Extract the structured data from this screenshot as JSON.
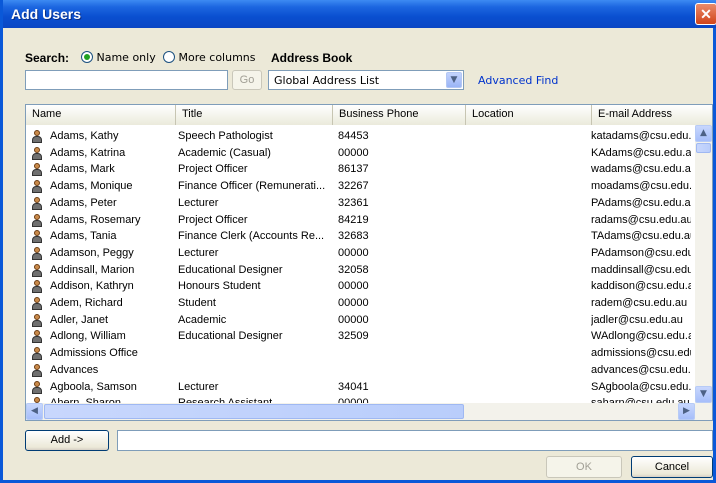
{
  "window": {
    "title": "Add Users",
    "close_glyph": "✕"
  },
  "search": {
    "label": "Search:",
    "option_name_only": "Name only",
    "option_more_columns": "More columns",
    "input_value": "",
    "go_label": "Go"
  },
  "address_book": {
    "label": "Address Book",
    "selected": "Global Address List",
    "advanced_find": "Advanced Find"
  },
  "columns": [
    "Name",
    "Title",
    "Business Phone",
    "Location",
    "E-mail Address"
  ],
  "rows": [
    {
      "name": "Adams, Kathy",
      "title": "Speech Pathologist",
      "phone": "84453",
      "location": "",
      "email": "katadams@csu.edu.au"
    },
    {
      "name": "Adams, Katrina",
      "title": "Academic (Casual)",
      "phone": "00000",
      "location": "",
      "email": "KAdams@csu.edu.au"
    },
    {
      "name": "Adams, Mark",
      "title": "Project Officer",
      "phone": "86137",
      "location": "",
      "email": "wadams@csu.edu.au"
    },
    {
      "name": "Adams, Monique",
      "title": "Finance Officer (Remunerati...",
      "phone": "32267",
      "location": "",
      "email": "moadams@csu.edu.au"
    },
    {
      "name": "Adams, Peter",
      "title": "Lecturer",
      "phone": "32361",
      "location": "",
      "email": "PAdams@csu.edu.au"
    },
    {
      "name": "Adams, Rosemary",
      "title": "Project Officer",
      "phone": "84219",
      "location": "",
      "email": "radams@csu.edu.au"
    },
    {
      "name": "Adams, Tania",
      "title": "Finance Clerk (Accounts Re...",
      "phone": "32683",
      "location": "",
      "email": "TAdams@csu.edu.au"
    },
    {
      "name": "Adamson, Peggy",
      "title": "Lecturer",
      "phone": "00000",
      "location": "",
      "email": "PAdamson@csu.edu.au"
    },
    {
      "name": "Addinsall, Marion",
      "title": "Educational Designer",
      "phone": "32058",
      "location": "",
      "email": "maddinsall@csu.edu.au"
    },
    {
      "name": "Addison, Kathryn",
      "title": "Honours Student",
      "phone": "00000",
      "location": "",
      "email": "kaddison@csu.edu.au"
    },
    {
      "name": "Adem, Richard",
      "title": "Student",
      "phone": "00000",
      "location": "",
      "email": "radem@csu.edu.au"
    },
    {
      "name": "Adler, Janet",
      "title": "Academic",
      "phone": "00000",
      "location": "",
      "email": "jadler@csu.edu.au"
    },
    {
      "name": "Adlong, William",
      "title": "Educational Designer",
      "phone": "32509",
      "location": "",
      "email": "WAdlong@csu.edu.au"
    },
    {
      "name": "Admissions Office",
      "title": "",
      "phone": "",
      "location": "",
      "email": "admissions@csu.edu.au"
    },
    {
      "name": "Advances",
      "title": "",
      "phone": "",
      "location": "",
      "email": "advances@csu.edu.au"
    },
    {
      "name": "Agboola, Samson",
      "title": "Lecturer",
      "phone": "34041",
      "location": "",
      "email": "SAgboola@csu.edu.au"
    },
    {
      "name": "Ahern, Sharon",
      "title": "Research Assistant",
      "phone": "00000",
      "location": "",
      "email": "saharn@csu.edu.au"
    }
  ],
  "footer": {
    "add_label": "Add ->",
    "add_value": "",
    "ok_label": "OK",
    "cancel_label": "Cancel"
  },
  "colors": {
    "title_bar": "#0a4fd0",
    "link": "#0033cc",
    "dialog_bg": "#ece9d8"
  },
  "icons": [
    "user-icon",
    "chevron-down-icon",
    "chevron-up-icon",
    "chevron-left-icon",
    "chevron-right-icon",
    "close-icon"
  ]
}
